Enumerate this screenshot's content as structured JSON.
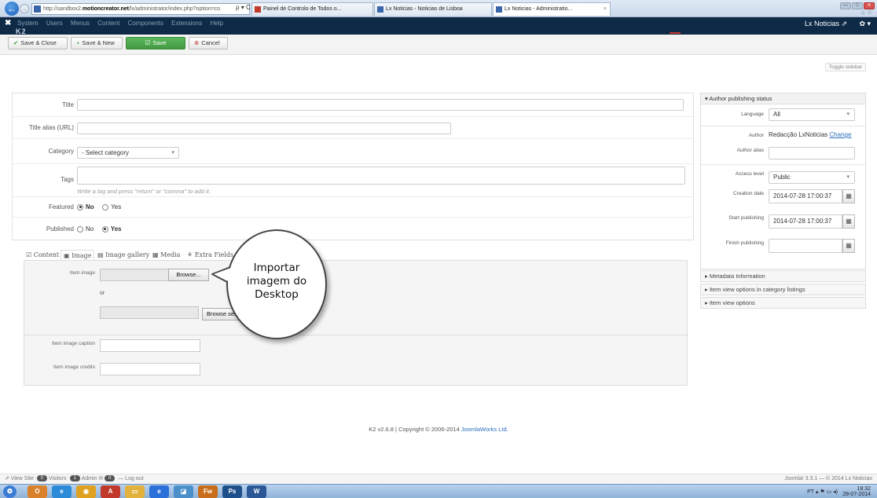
{
  "browser": {
    "url_prefix": "http://sandbox2.",
    "url_domain": "motioncreator.net",
    "url_rest": "/lx/administrator/index.php?option=co",
    "addr_tools": "ρ ▾ C",
    "tabs": [
      {
        "label": "Painel de Controlo de Todos o..."
      },
      {
        "label": "Lx Noticias - Noticias de Lisboa"
      },
      {
        "label": "Lx Noticias - Administratio..."
      }
    ],
    "tab_close": "×",
    "win_min": "—",
    "win_max": "□",
    "win_close": "✕",
    "fav_icons": "⌂ ☆",
    "back": "←",
    "fwd": "→"
  },
  "admin_bar": {
    "logo": "✖",
    "menu": [
      "System",
      "Users",
      "Menus",
      "Content",
      "Components",
      "Extensions",
      "Help"
    ],
    "site_name": "Lx Noticias ⇗",
    "gear": "✿ ▾",
    "k2": "K2"
  },
  "toolbar": {
    "save_close": "Save & Close",
    "save_new": "Save & New",
    "save": "Save",
    "cancel": "Cancel",
    "icon_check": "✔",
    "icon_plus": "+",
    "icon_edit": "☑",
    "icon_cancel": "⊗"
  },
  "toggle_sidebar": "Toggle sidebar",
  "form": {
    "title_label": "Title",
    "alias_label": "Title alias (URL)",
    "category_label": "Category",
    "category_value": "- Select category",
    "tags_label": "Tags",
    "tags_hint": "Write a tag and press \"return\" or \"comma\" to add it.",
    "featured_label": "Featured",
    "published_label": "Published",
    "no": "No",
    "yes": "Yes",
    "caret": "▾"
  },
  "tabs": [
    {
      "label": "☑ Content"
    },
    {
      "label": "▣ Image"
    },
    {
      "label": "▤ Image gallery"
    },
    {
      "label": "▦ Media"
    },
    {
      "label": "⚘ Extra Fields"
    }
  ],
  "image_panel": {
    "item_image_label": "Item image",
    "browse": "Browse...",
    "or": "or",
    "browse_server": "Browse server",
    "caption_label": "Item image caption",
    "credits_label": "Item image credits"
  },
  "callout": {
    "line1": "Importar",
    "line2": "imagem do",
    "line3": "Desktop"
  },
  "sidebar": {
    "header": "▾ Author publishing status",
    "language_label": "Language",
    "language_value": "All",
    "author_label": "Author",
    "author_value": "Redacção LxNoticias",
    "author_change": "Change",
    "alias_label": "Author alias",
    "access_label": "Access level",
    "access_value": "Public",
    "creation_label": "Creation date",
    "creation_value": "2014-07-28 17:00:37",
    "start_label": "Start publishing",
    "start_value": "2014-07-28 17:00:37",
    "finish_label": "Finish publishing",
    "cal_icon": "▦",
    "caret": "▾",
    "accordions": [
      "▸ Metadata Information",
      "▸ Item view options in category listings",
      "▸ Item view options"
    ]
  },
  "footer": {
    "version": "K2 v2.6.8 | Copyright © 2006-2014 ",
    "company": "JoomlaWorks Ltd."
  },
  "status_bar": {
    "view_site": "⇗ View Site",
    "visitors_count": "0",
    "visitors": "Visitors",
    "admin_count": "1",
    "admin": "Admin",
    "msg_count": "0",
    "logout": "— Log out",
    "msg_icon": "✉",
    "right": "Joomla! 3.3.1 — © 2014 Lx Noticias"
  },
  "taskbar": {
    "apps": [
      {
        "label": "❂",
        "color": "#3a7bd5"
      },
      {
        "label": "O",
        "color": "#d9822b"
      },
      {
        "label": "e",
        "color": "#2b8bd9"
      },
      {
        "label": "◉",
        "color": "#e0a020"
      },
      {
        "label": "A",
        "color": "#c0392b"
      },
      {
        "label": "▭",
        "color": "#e3b23c"
      },
      {
        "label": "e",
        "color": "#2b6fd9"
      },
      {
        "label": "◪",
        "color": "#4a8fc9"
      },
      {
        "label": "Fw",
        "color": "#c96f1c"
      },
      {
        "label": "Ps",
        "color": "#1d4f8a"
      },
      {
        "label": "W",
        "color": "#2b5797"
      }
    ],
    "lang": "PT",
    "time": "18:32",
    "date": "28-07-2014",
    "tray": "▴ ⚑ ▭ ◂)"
  },
  "colors": {
    "admin_bar": "#0e2a47",
    "save_green": "#5cb85c",
    "link": "#2a6ebb",
    "cancel_red": "#c0392b"
  }
}
